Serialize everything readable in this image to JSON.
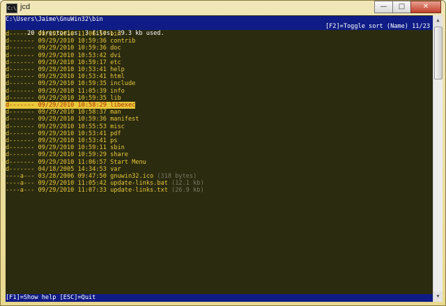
{
  "window": {
    "title": "jcd",
    "minimize": "—",
    "maximize": "□",
    "close": "✕",
    "app_icon": "C:\\"
  },
  "console": {
    "path": "C:\\Users\\Jaime\\GnuWin32\\bin",
    "status_left": "20 directories, 3 files; 39.3 kb used.",
    "status_right": "[F2]=Toggle sort (Name) 11/23",
    "help": "[F1]=Show help [ESC]=Quit",
    "entries": [
      {
        "attr": "d-------",
        "date": "09/29/2010 11:06:57",
        "name": "bin",
        "size": ""
      },
      {
        "attr": "d-------",
        "date": "09/29/2010 10:59:36",
        "name": "contrib",
        "size": ""
      },
      {
        "attr": "d-------",
        "date": "09/29/2010 10:59:36",
        "name": "doc",
        "size": ""
      },
      {
        "attr": "d-------",
        "date": "09/29/2010 10:53:42",
        "name": "dvi",
        "size": ""
      },
      {
        "attr": "d-------",
        "date": "09/29/2010 10:59:17",
        "name": "etc",
        "size": ""
      },
      {
        "attr": "d-------",
        "date": "09/29/2010 10:53:41",
        "name": "help",
        "size": ""
      },
      {
        "attr": "d-------",
        "date": "09/29/2010 10:53:41",
        "name": "html",
        "size": ""
      },
      {
        "attr": "d-------",
        "date": "09/29/2010 10:59:35",
        "name": "include",
        "size": ""
      },
      {
        "attr": "d-------",
        "date": "09/29/2010 11:05:39",
        "name": "info",
        "size": ""
      },
      {
        "attr": "d-------",
        "date": "09/29/2010 10:59:35",
        "name": "lib",
        "size": ""
      },
      {
        "attr": "d-------",
        "date": "09/29/2010 10:58:29",
        "name": "libexec",
        "size": "",
        "selected": true
      },
      {
        "attr": "d-------",
        "date": "09/29/2010 10:58:37",
        "name": "man",
        "size": ""
      },
      {
        "attr": "d-------",
        "date": "09/29/2010 10:59:36",
        "name": "manifest",
        "size": ""
      },
      {
        "attr": "d-------",
        "date": "09/29/2010 10:55:53",
        "name": "misc",
        "size": ""
      },
      {
        "attr": "d-------",
        "date": "09/29/2010 10:53:41",
        "name": "pdf",
        "size": ""
      },
      {
        "attr": "d-------",
        "date": "09/29/2010 10:53:41",
        "name": "ps",
        "size": ""
      },
      {
        "attr": "d-------",
        "date": "09/29/2010 10:59:11",
        "name": "sbin",
        "size": ""
      },
      {
        "attr": "d-------",
        "date": "09/29/2010 10:59:29",
        "name": "share",
        "size": ""
      },
      {
        "attr": "d-------",
        "date": "09/29/2010 11:06:57",
        "name": "Start Menu",
        "size": ""
      },
      {
        "attr": "d-------",
        "date": "04/18/2005 14:34:53",
        "name": "var",
        "size": ""
      },
      {
        "attr": "----a---",
        "date": "03/28/2006 09:47:50",
        "name": "gnuwin32.ico",
        "size": "(318 bytes)"
      },
      {
        "attr": "----a---",
        "date": "09/29/2010 11:05:42",
        "name": "update-links.bat",
        "size": "(12.1 kb)"
      },
      {
        "attr": "----a---",
        "date": "09/29/2010 11:07:33",
        "name": "update-links.txt",
        "size": "(26.9 kb)"
      }
    ]
  },
  "colors": {
    "console_bg": "#2b2b10",
    "bar_bg": "#0f1c86",
    "text": "#e8c83a",
    "selected_text": "#b02a00",
    "dim": "#7a7a66"
  }
}
